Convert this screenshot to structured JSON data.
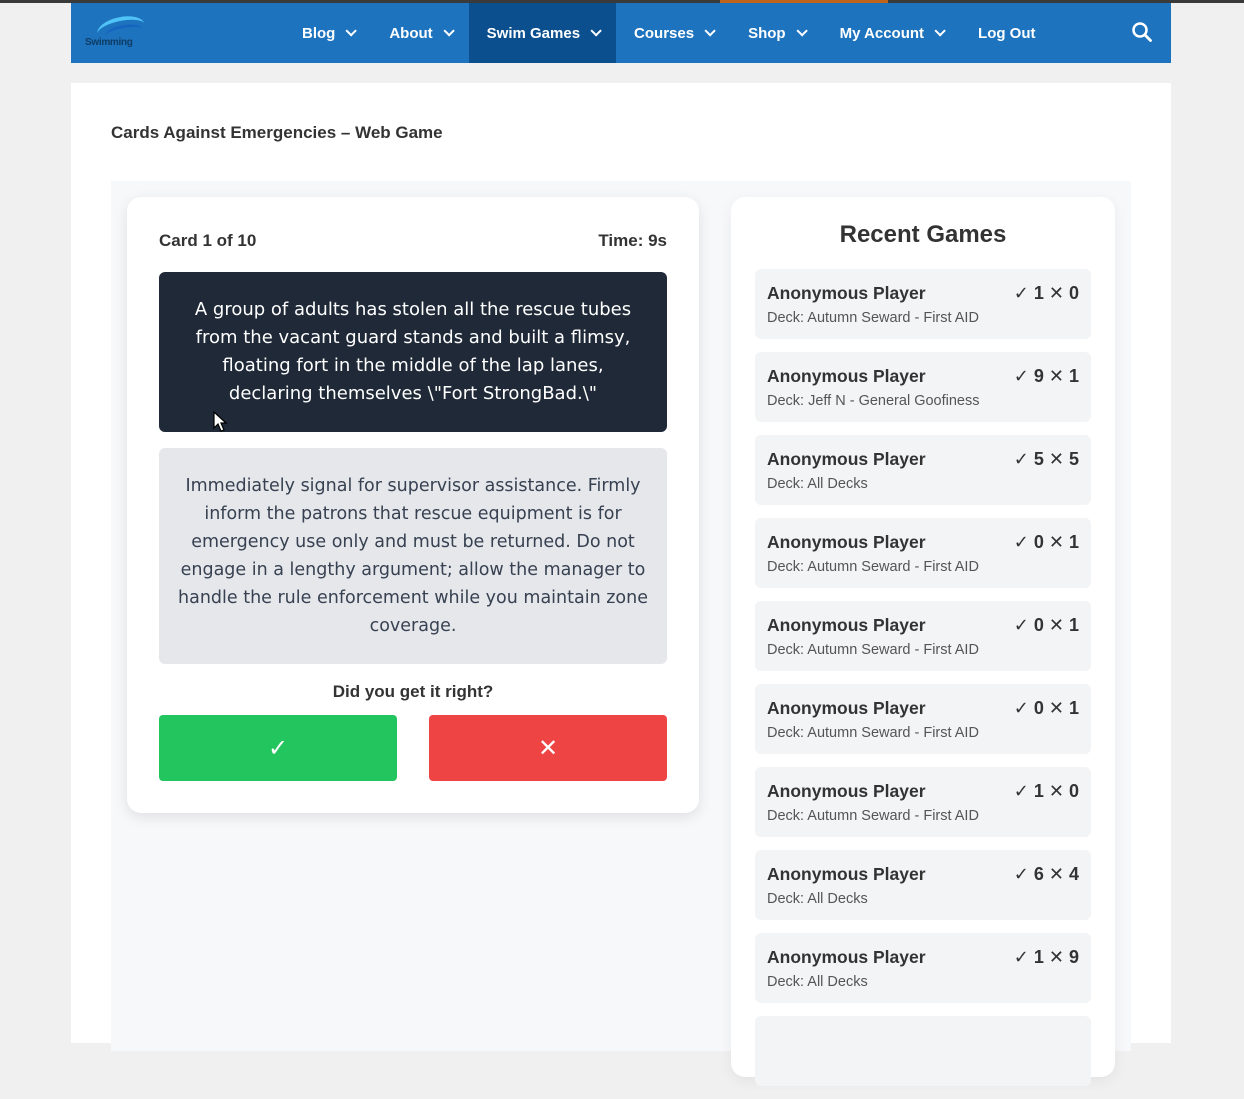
{
  "site": {
    "logo_text": "Swimming"
  },
  "nav": {
    "items": [
      {
        "label": "Blog",
        "has_dropdown": true
      },
      {
        "label": "About",
        "has_dropdown": true
      },
      {
        "label": "Swim Games",
        "has_dropdown": true,
        "active": true
      },
      {
        "label": "Courses",
        "has_dropdown": true
      },
      {
        "label": "Shop",
        "has_dropdown": true
      },
      {
        "label": "My Account",
        "has_dropdown": true
      },
      {
        "label": "Log Out",
        "has_dropdown": false
      }
    ],
    "search_icon": "search-icon"
  },
  "page": {
    "title": "Cards Against Emergencies – Web Game"
  },
  "game": {
    "card_counter": "Card 1 of 10",
    "timer": "Time: 9s",
    "prompt": "A group of adults has stolen all the rescue tubes from the vacant guard stands and built a flimsy, floating fort in the middle of the lap lanes, declaring themselves \\\"Fort StrongBad.\\\"",
    "answer": "Immediately signal for supervisor assistance. Firmly inform the patrons that rescue equipment is for emergency use only and must be returned. Do not engage in a lengthy argument; allow the manager to handle the rule enforcement while you maintain zone coverage.",
    "question": "Did you get it right?",
    "right_label": "✓",
    "wrong_label": "✕"
  },
  "recent": {
    "title": "Recent Games",
    "games": [
      {
        "player": "Anonymous Player",
        "deck": "Deck: Autumn Seward - First AID",
        "score": "✓ 1 ✕ 0"
      },
      {
        "player": "Anonymous Player",
        "deck": "Deck: Jeff N - General Goofiness",
        "score": "✓ 9 ✕ 1"
      },
      {
        "player": "Anonymous Player",
        "deck": "Deck: All Decks",
        "score": "✓ 5 ✕ 5"
      },
      {
        "player": "Anonymous Player",
        "deck": "Deck: Autumn Seward - First AID",
        "score": "✓ 0 ✕ 1"
      },
      {
        "player": "Anonymous Player",
        "deck": "Deck: Autumn Seward - First AID",
        "score": "✓ 0 ✕ 1"
      },
      {
        "player": "Anonymous Player",
        "deck": "Deck: Autumn Seward - First AID",
        "score": "✓ 0 ✕ 1"
      },
      {
        "player": "Anonymous Player",
        "deck": "Deck: Autumn Seward - First AID",
        "score": "✓ 1 ✕ 0"
      },
      {
        "player": "Anonymous Player",
        "deck": "Deck: All Decks",
        "score": "✓ 6 ✕ 4"
      },
      {
        "player": "Anonymous Player",
        "deck": "Deck: All Decks",
        "score": "✓ 1 ✕ 9"
      }
    ]
  },
  "colors": {
    "nav_bg": "#1e73be",
    "nav_active": "#0b4f8f",
    "prompt_bg": "#1f2937",
    "answer_bg": "#e5e7eb",
    "right_btn": "#22c55e",
    "wrong_btn": "#ef4444"
  }
}
